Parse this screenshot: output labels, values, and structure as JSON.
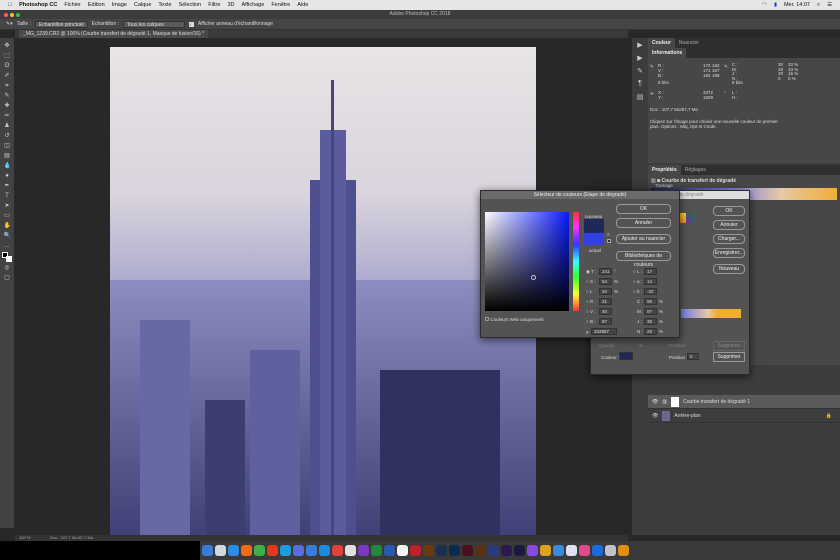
{
  "menubar": {
    "apple": "",
    "app": "Photoshop CC",
    "items": [
      "Fichier",
      "Edition",
      "Image",
      "Calque",
      "Texte",
      "Sélection",
      "Filtre",
      "3D",
      "Affichage",
      "Fenêtre",
      "Aide"
    ],
    "clock": "Mer. 14:07"
  },
  "window": {
    "title": "Adobe Photoshop CC 2018"
  },
  "options": {
    "size_label": "Taille :",
    "size_value": "Echantillon ponctuel",
    "sample_label": "Echantillon :",
    "sample_value": "Tous les calques",
    "ring_label": "Afficher anneau d'échantillonnage",
    "ring_checked": true
  },
  "document": {
    "tab": "_MG_1239.CR2 @ 100% (Courbe transfert de dégradé 1, Masque de fusion/16) *",
    "zoom": "100 %",
    "doc_size": "Doc : 107,7 Mo/87,7 Mo"
  },
  "panels": {
    "color_tabs": [
      "Couleur",
      "Nuancier"
    ],
    "info_tab": "Informations",
    "info": {
      "rgb_labels": [
        "R :",
        "V :",
        "B :"
      ],
      "rgb_a": [
        "172",
        "171",
        "184"
      ],
      "rgb_b": [
        "162",
        "157",
        "198"
      ],
      "cmyk_labels": [
        "C :",
        "M :",
        "J :",
        "N :"
      ],
      "cmyk_a": [
        "30",
        "29",
        "20",
        "0"
      ],
      "cmyk_b": [
        "33 %",
        "33 %",
        "16 %",
        "0 %"
      ],
      "bits_a": "8 bits",
      "bits_b": "8 bits",
      "xy_labels": [
        "X :",
        "Y :"
      ],
      "xy": [
        "3372",
        "1809"
      ],
      "wh_labels": [
        "L :",
        "H :"
      ],
      "doc": "Doc : 107,7 Mo/87,7 Mo",
      "hint": "Cliquez sur l'image pour choisir une nouvelle couleur de premier plan. Options : Maj, Opt et Cmde."
    },
    "props_tabs": [
      "Propriétés",
      "Réglages"
    ],
    "props_title": "Courbe de transfert de dégradé",
    "layers": [
      {
        "name": "Courbe transfert de dégradé 1"
      },
      {
        "name": "Arrière-plan"
      }
    ]
  },
  "gradient_editor": {
    "title": "Editeur de dégradé",
    "ok": "OK",
    "cancel": "Annuler",
    "load": "Charger...",
    "save": "Enregistrer...",
    "new": "Nouveau",
    "opacity_label": "Opacité :",
    "opacity_unit": "%",
    "position_label": "Position :",
    "delete": "Supprimer",
    "color_label": "Couleur :",
    "position_value": "0",
    "stop_color": "#202857",
    "gradient": [
      "#202857",
      "#6f78e6",
      "#e6c9a6",
      "#f0ad33"
    ],
    "framing": "Tramage"
  },
  "color_picker": {
    "title": "Sélecteur de couleurs (Etape de dégradé)",
    "ok": "OK",
    "cancel": "Annuler",
    "add_swatch": "Ajouter au nuancier",
    "libraries": "Bibliothèques de couleurs",
    "new_label": "nouveau",
    "current_label": "actuel",
    "new_color": "#202857",
    "current_color": "#3340e6",
    "web_only": "Couleurs Web uniquement",
    "fields": {
      "T": "241",
      "S": "54",
      "L": "34",
      "R": "31",
      "V": "40",
      "B": "87",
      "Lab_L": "17",
      "a": "14",
      "b": "-32",
      "C": "99",
      "M": "97",
      "J": "35",
      "N": "29",
      "hex": "202857"
    },
    "labels": {
      "T": "T :",
      "S": "S :",
      "Lum": "L :",
      "R": "R :",
      "V": "V :",
      "B": "B :",
      "Lab_L": "L :",
      "a": "a :",
      "b": "b :",
      "C": "C :",
      "M": "M :",
      "J": "J :",
      "N": "N :",
      "hash": "#",
      "deg": "°",
      "pct": "%"
    }
  },
  "dock": {
    "colors": [
      "#3a7bd5",
      "#d0d8e0",
      "#2a8ee8",
      "#f06a1a",
      "#3cb043",
      "#e03a1a",
      "#1e9be0",
      "#5b6be0",
      "#3a7be0",
      "#1a8ce0",
      "#e04040",
      "#e0e0e0",
      "#7a3ac0",
      "#1f8a3e",
      "#2a5ab0",
      "#f4f4f4",
      "#c0202a",
      "#6a3a10",
      "#1a3050",
      "#0a2a50",
      "#4a1020",
      "#5a3010",
      "#2a3a80",
      "#2a1a50",
      "#1a1a40",
      "#8a4ae0",
      "#e0a020",
      "#3a8ae0",
      "#e0e0f0",
      "#e04a8a",
      "#1a6ae0",
      "#c0c0d0",
      "#e09010"
    ]
  }
}
